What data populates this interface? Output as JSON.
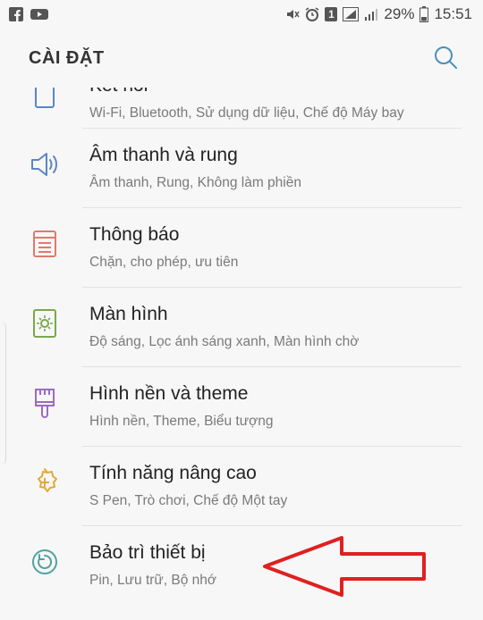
{
  "status_bar": {
    "battery_percent": "29%",
    "time": "15:51",
    "sim_badge": "1"
  },
  "header": {
    "title": "CÀI ĐẶT"
  },
  "items": [
    {
      "label": "Kết nối",
      "sub": "Wi-Fi, Bluetooth, Sử dụng dữ liệu, Chế độ Máy bay",
      "icon": "connections-icon"
    },
    {
      "label": "Âm thanh và rung",
      "sub": "Âm thanh, Rung, Không làm phiền",
      "icon": "speaker-icon"
    },
    {
      "label": "Thông báo",
      "sub": "Chặn, cho phép, ưu tiên",
      "icon": "notification-icon"
    },
    {
      "label": "Màn hình",
      "sub": "Độ sáng, Lọc ánh sáng xanh, Màn hình chờ",
      "icon": "display-icon"
    },
    {
      "label": "Hình nền và theme",
      "sub": "Hình nền, Theme, Biểu tượng",
      "icon": "paintbrush-icon"
    },
    {
      "label": "Tính năng nâng cao",
      "sub": "S Pen, Trò chơi, Chế độ Một tay",
      "icon": "gear-plus-icon"
    },
    {
      "label": "Bảo trì thiết bị",
      "sub": "Pin, Lưu trữ, Bộ nhớ",
      "icon": "maintenance-icon"
    }
  ],
  "colors": {
    "arrow": "#e02020",
    "icon_blue": "#5b86c5",
    "icon_salmon": "#e07a6a",
    "icon_green": "#7aa84a",
    "icon_purple": "#9b6bc0",
    "icon_orange": "#e3a93a",
    "icon_teal": "#4fa3a0"
  }
}
